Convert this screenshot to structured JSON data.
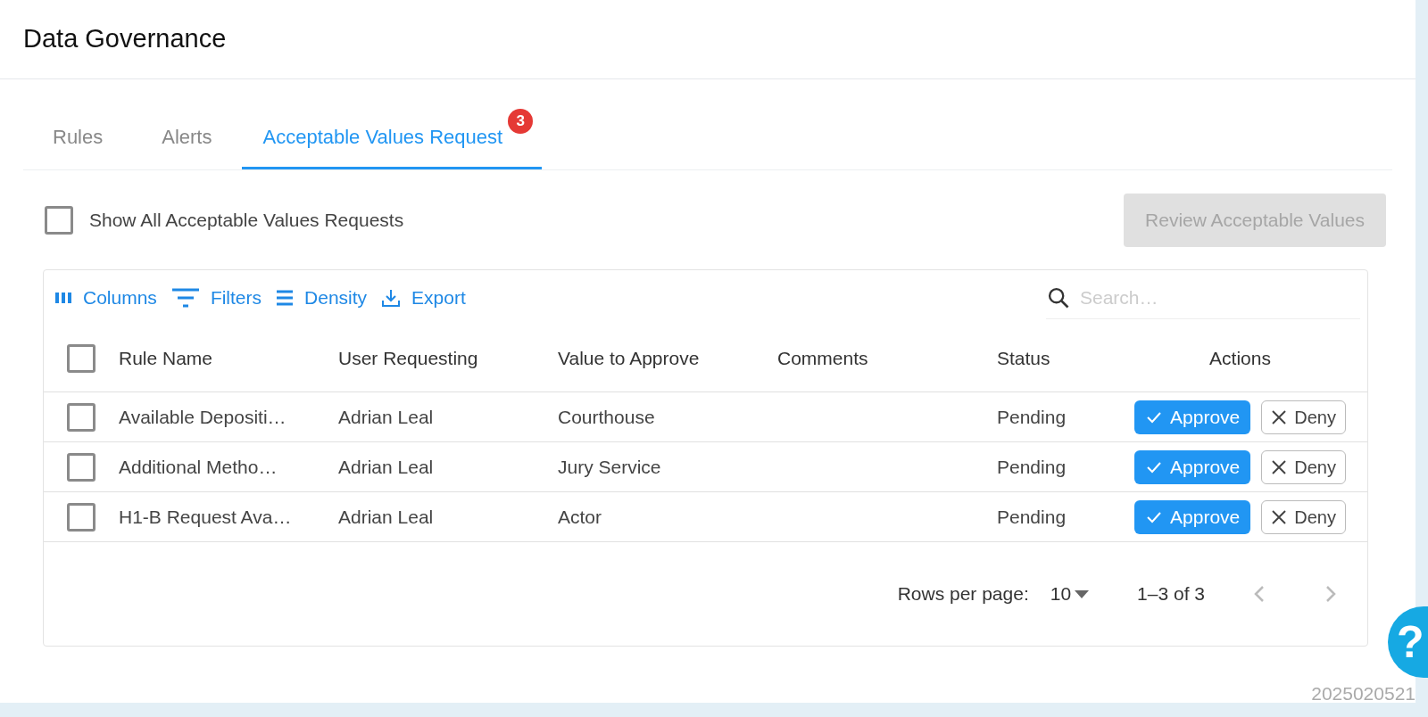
{
  "page": {
    "title": "Data Governance"
  },
  "tabs": [
    {
      "label": "Rules",
      "selected": false
    },
    {
      "label": "Alerts",
      "selected": false
    },
    {
      "label": "Acceptable Values Request",
      "selected": true,
      "badge": "3"
    }
  ],
  "show_all": {
    "label": "Show All Acceptable Values Requests",
    "checked": false
  },
  "review_button": {
    "label": "Review Acceptable Values",
    "disabled": true
  },
  "toolbar": [
    {
      "kind": "columns",
      "label": "Columns"
    },
    {
      "kind": "filters",
      "label": "Filters"
    },
    {
      "kind": "density",
      "label": "Density"
    },
    {
      "kind": "export",
      "label": "Export"
    }
  ],
  "search": {
    "placeholder": "Search…"
  },
  "table": {
    "columns": [
      "Rule Name",
      "User Requesting",
      "Value to Approve",
      "Comments",
      "Status",
      "Actions"
    ],
    "select_all_checked": false,
    "rows": [
      {
        "checked": false,
        "cells": [
          "Available Depositi…",
          "Adrian Leal",
          "Courthouse",
          "",
          "Pending"
        ],
        "approve": "Approve",
        "deny": "Deny"
      },
      {
        "checked": false,
        "cells": [
          "Additional Metho…",
          "Adrian Leal",
          "Jury Service",
          "",
          "Pending"
        ],
        "approve": "Approve",
        "deny": "Deny"
      },
      {
        "checked": false,
        "cells": [
          "H1-B Request Ava…",
          "Adrian Leal",
          "Actor",
          "",
          "Pending"
        ],
        "approve": "Approve",
        "deny": "Deny"
      }
    ]
  },
  "pagination": {
    "rows_per_page_label": "Rows per page:",
    "rows_per_page": "10",
    "range": "1–3 of 3"
  },
  "help_button": {
    "label": "?"
  },
  "footer_code": "2025020521"
}
